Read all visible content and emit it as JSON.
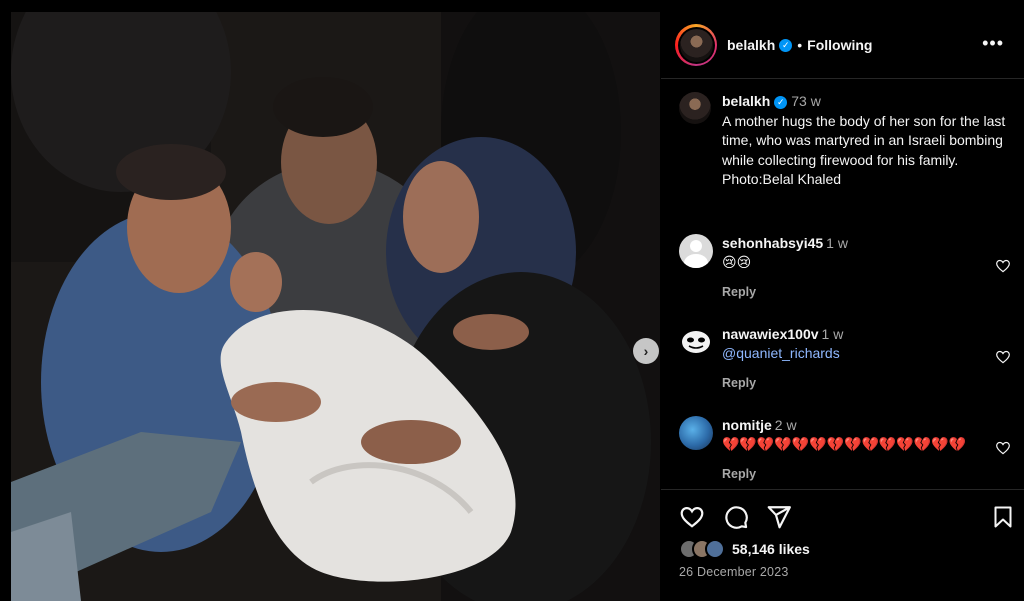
{
  "post": {
    "author": "belalkh",
    "follow_state": "Following",
    "more_icon": "•••",
    "caption": {
      "user": "belalkh",
      "time": "73 w",
      "text": "A mother hugs the body of her son for the last time, who was martyred in an Israeli bombing while collecting firewood for his family.\nPhoto:Belal Khaled"
    },
    "comments": [
      {
        "user": "sehonhabsyi45",
        "time": "1 w",
        "text": "😢😢",
        "reply": "Reply",
        "avatar": "default-avatar-icon"
      },
      {
        "user": "nawawiex100v",
        "time": "1 w",
        "text": "@quaniet_richards",
        "reply": "Reply",
        "avatar": "mask-avatar-icon"
      },
      {
        "user": "nomitje",
        "time": "2 w",
        "text": "💔💔💔💔💔💔💔💔💔💔💔💔💔💔",
        "reply": "Reply",
        "avatar": "earth-avatar-icon"
      }
    ],
    "likes": "58,146 likes",
    "date": "26 December 2023"
  },
  "icons": {
    "verified": "✓",
    "next": "›"
  },
  "colors": {
    "background": "#000000",
    "text": "#f5f5f5",
    "muted": "#a8a8a8",
    "verified": "#0095f6",
    "divider": "#262626"
  }
}
